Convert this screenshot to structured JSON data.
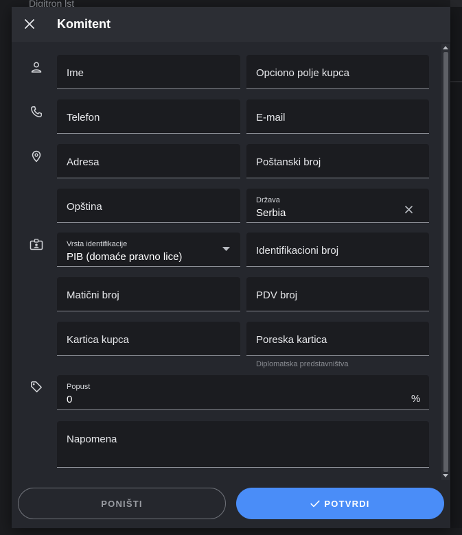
{
  "background": {
    "title": "Digitron lst"
  },
  "dialog": {
    "title": "Komitent",
    "close_icon": "close-icon"
  },
  "fields": {
    "ime": {
      "label": "Ime"
    },
    "opciono_polje": {
      "label": "Opciono polje kupca"
    },
    "telefon": {
      "label": "Telefon"
    },
    "email": {
      "label": "E-mail"
    },
    "adresa": {
      "label": "Adresa"
    },
    "postanski_broj": {
      "label": "Poštanski broj"
    },
    "opstina": {
      "label": "Opština"
    },
    "drzava": {
      "label": "Država",
      "value": "Serbia"
    },
    "vrsta_identifikacije": {
      "label": "Vrsta identifikacije",
      "value": "PIB (domaće pravno lice)"
    },
    "identifikacioni_broj": {
      "label": "Identifikacioni broj"
    },
    "maticni_broj": {
      "label": "Matični broj"
    },
    "pdv_broj": {
      "label": "PDV broj"
    },
    "kartica_kupca": {
      "label": "Kartica kupca"
    },
    "poreska_kartica": {
      "label": "Poreska kartica",
      "helper": "Diplomatska predstavništva"
    },
    "popust": {
      "label": "Popust",
      "value": "0",
      "suffix": "%"
    },
    "napomena": {
      "label": "Napomena"
    }
  },
  "icons": {
    "person": "person-icon",
    "phone": "phone-icon",
    "location": "location-pin-icon",
    "id_card": "id-card-icon",
    "tag": "tag-icon"
  },
  "footer": {
    "cancel_label": "PONIŠTI",
    "confirm_label": "POTVRDI"
  },
  "colors": {
    "accent": "#4a8df8",
    "dialog_bg": "#25272d",
    "field_bg": "#1b1c20"
  }
}
